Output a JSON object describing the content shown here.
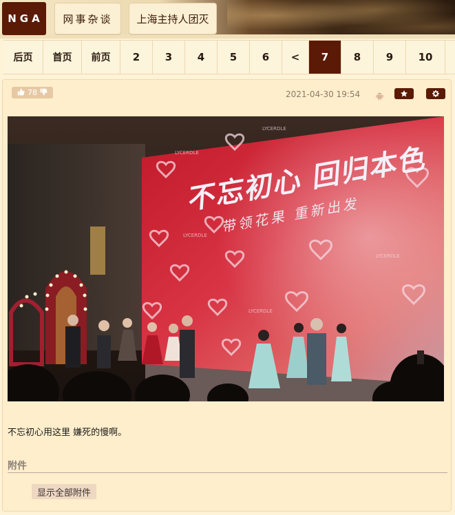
{
  "header": {
    "logo": "NGA",
    "breadcrumbs": [
      "网事杂谈",
      "上海主持人团灭"
    ]
  },
  "pager": {
    "items": [
      {
        "label": "后页",
        "active": false
      },
      {
        "label": "首页",
        "active": false
      },
      {
        "label": "前页",
        "active": false
      },
      {
        "label": "2",
        "active": false
      },
      {
        "label": "3",
        "active": false
      },
      {
        "label": "4",
        "active": false
      },
      {
        "label": "5",
        "active": false
      },
      {
        "label": "6",
        "active": false
      },
      {
        "label": "<",
        "active": false
      },
      {
        "label": "7",
        "active": true
      },
      {
        "label": "8",
        "active": false
      },
      {
        "label": "9",
        "active": false
      },
      {
        "label": "10",
        "active": false
      }
    ]
  },
  "post": {
    "votes": "78",
    "datetime": "2021-04-30 19:54",
    "image": {
      "screen_headline": "不忘初心 回归本色",
      "screen_subline": "带领花果 重新出发",
      "brand_text": "LYCERDLE"
    },
    "text": "不忘初心用这里 嫌死的慢啊。",
    "attachments_title": "附件",
    "show_all_attachments": "显示全部附件"
  },
  "icons": {
    "thumbs_up": "thumbs-up-icon",
    "thumbs_down": "thumbs-down-icon",
    "android": "android-icon",
    "star": "star-icon",
    "gear": "gear-icon"
  },
  "colors": {
    "brand": "#5a1a06",
    "background": "#fef3d6",
    "vote_bg": "#e6c9a4"
  }
}
